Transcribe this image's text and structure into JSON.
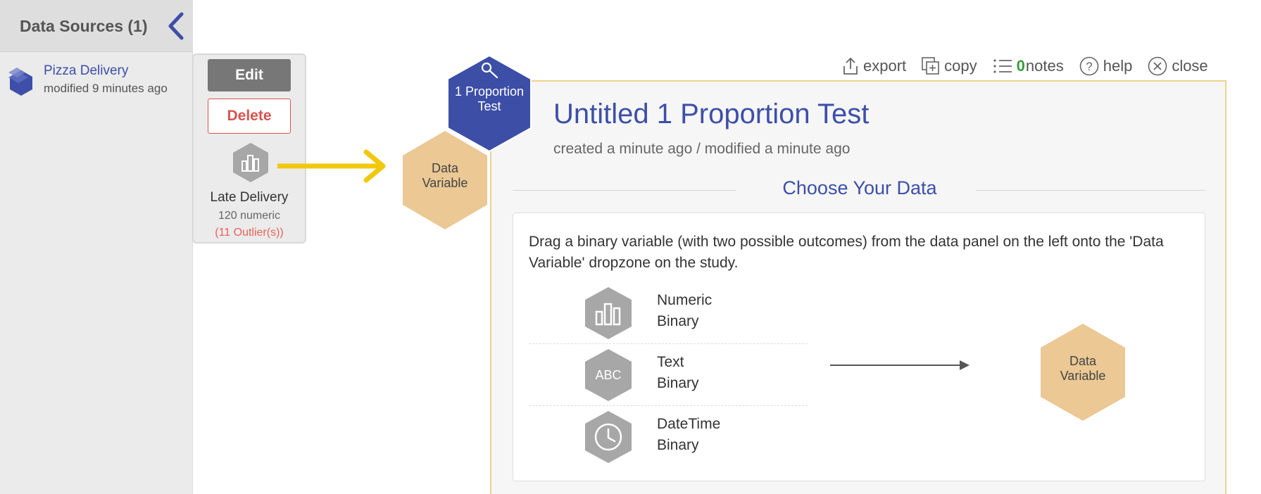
{
  "sidebar": {
    "title": "Data Sources (1)",
    "collapse_icon": "chevron-left-icon",
    "data_source": {
      "name": "Pizza Delivery",
      "meta": "modified 9 minutes ago",
      "icon": "dataset-stack-icon"
    }
  },
  "popover": {
    "edit_label": "Edit",
    "delete_label": "Delete",
    "variable": {
      "name": "Late Delivery",
      "type": "120 numeric",
      "outliers": "(11 Outlier(s))",
      "icon": "bar-chart-icon"
    }
  },
  "study": {
    "node_label_line1": "1 Proportion",
    "node_label_line2": "Test",
    "data_node_line1": "Data",
    "data_node_line2": "Variable",
    "title": "Untitled 1 Proportion Test",
    "meta": "created a minute ago / modified a minute ago",
    "section_title": "Choose Your Data",
    "instruction": "Drag a binary variable (with two possible outcomes) from the data panel on the left onto the 'Data Variable' dropzone on the study.",
    "types": [
      {
        "line1": "Numeric",
        "line2": "Binary",
        "icon": "bar-chart-icon"
      },
      {
        "line1": "Text",
        "line2": "Binary",
        "icon": "abc-text-icon",
        "glyph": "ABC"
      },
      {
        "line1": "DateTime",
        "line2": "Binary",
        "icon": "clock-icon"
      }
    ],
    "dropzone_line1": "Data",
    "dropzone_line2": "Variable"
  },
  "toolbar": {
    "export_label": "export",
    "copy_label": "copy",
    "notes_count": "0",
    "notes_label": "notes",
    "help_label": "help",
    "close_label": "close"
  },
  "colors": {
    "brand_blue": "#3d4fa8",
    "test_hex": "#3c4ea6",
    "data_hex": "#ebc894",
    "type_hex": "#a7a7a7",
    "drag_arrow": "#f2c80f",
    "delete_red": "#d9534f",
    "notes_green": "#3a9c3a"
  }
}
